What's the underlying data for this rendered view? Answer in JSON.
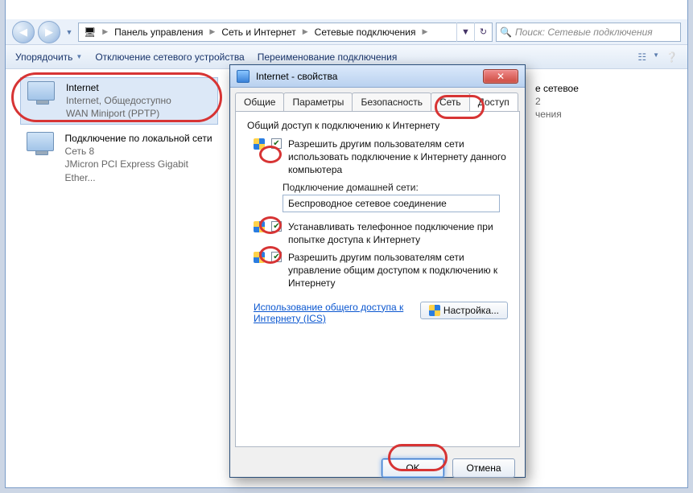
{
  "titlebar_buttons": {
    "min": "—",
    "max": "☐",
    "close": "✕"
  },
  "nav": {
    "back": "◀",
    "fwd": "▶",
    "crumbs": [
      "Панель управления",
      "Сеть и Интернет",
      "Сетевые подключения"
    ],
    "search_placeholder": "Поиск: Сетевые подключения"
  },
  "toolbar": {
    "organize": "Упорядочить",
    "disable": "Отключение сетевого устройства",
    "rename": "Переименование подключения"
  },
  "connections": [
    {
      "title": "Internet",
      "line2": "Internet, Общедоступно",
      "line3": "WAN Miniport (PPTP)"
    },
    {
      "title": "Подключение по локальной сети",
      "line2": "Сеть 8",
      "line3": "JMicron PCI Express Gigabit Ether..."
    },
    {
      "title": "е сетевое",
      "line2": "2",
      "line3": "чения"
    }
  ],
  "dialog": {
    "title": "Internet - свойства",
    "close_glyph": "✕",
    "tabs": {
      "general": "Общие",
      "params": "Параметры",
      "security": "Безопасность",
      "network": "Сеть",
      "access": "Доступ"
    },
    "section": "Общий доступ к подключению к Интернету",
    "opt1": "Разрешить другим пользователям сети использовать подключение к Интернету данного компьютера",
    "home_label": "Подключение домашней сети:",
    "home_value": "Беспроводное сетевое соединение",
    "opt2": "Устанавливать телефонное подключение при попытке доступа к Интернету",
    "opt3": "Разрешить другим пользователям сети управление общим доступом к подключению к Интернету",
    "link": "Использование общего доступа к Интернету (ICS)",
    "settings_btn": "Настройка...",
    "ok": "OK",
    "cancel": "Отмена"
  }
}
